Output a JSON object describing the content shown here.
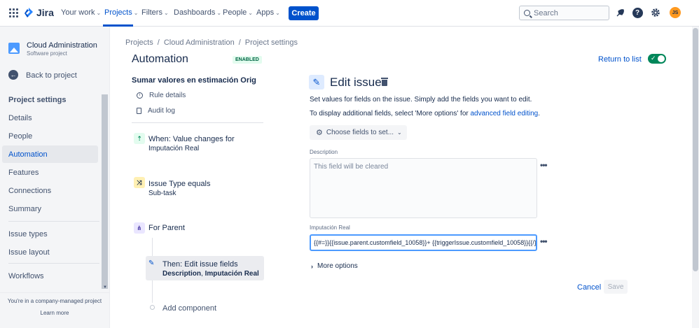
{
  "topnav": {
    "logo": "Jira",
    "items": [
      {
        "label": "Your work",
        "chevron": true
      },
      {
        "label": "Projects",
        "chevron": true,
        "active": true
      },
      {
        "label": "Filters",
        "chevron": true
      },
      {
        "label": "Dashboards",
        "chevron": true
      },
      {
        "label": "People",
        "chevron": true
      },
      {
        "label": "Apps",
        "chevron": true
      }
    ],
    "create_label": "Create",
    "search_placeholder": "Search",
    "avatar_initials": "JS",
    "icons": [
      "apps-grid-icon",
      "notification-icon",
      "help-icon",
      "settings-icon"
    ]
  },
  "sidebar": {
    "project_name": "Cloud Administration",
    "project_type": "Software project",
    "back_label": "Back to project",
    "heading": "Project settings",
    "items": [
      {
        "label": "Details"
      },
      {
        "label": "People"
      },
      {
        "label": "Automation",
        "active": true
      },
      {
        "label": "Features"
      },
      {
        "label": "Connections"
      },
      {
        "label": "Summary"
      },
      {
        "label": "Issue types"
      },
      {
        "label": "Issue layout"
      },
      {
        "label": "Workflows"
      }
    ],
    "footer_text": "You're in a company-managed project",
    "footer_link": "Learn more"
  },
  "breadcrumb": [
    "Projects",
    "/",
    "Cloud Administration",
    "/",
    "Project settings"
  ],
  "page": {
    "title": "Automation",
    "status_badge": "ENABLED",
    "return_label": "Return to list",
    "toggle_enabled": true
  },
  "rule": {
    "name": "Sumar valores en estimación Orig",
    "links": [
      "Rule details",
      "Audit log"
    ],
    "steps": [
      {
        "title": "When: Value changes for",
        "subtitle": "Imputación Real",
        "icon": "trigger-icon",
        "color": "#e3fcef"
      },
      {
        "title": "Issue Type equals",
        "subtitle": "Sub-task",
        "icon": "condition-icon",
        "color": "#fff0b3"
      },
      {
        "title": "For Parent",
        "subtitle": "",
        "icon": "branch-icon",
        "color": "#eae6ff"
      }
    ],
    "selected_action": {
      "title": "Then: Edit issue fields",
      "fields": [
        "Description",
        "Imputación Real"
      ],
      "separator": ", "
    },
    "add_component": "Add component"
  },
  "edit_panel": {
    "title": "Edit issue",
    "help_line1": "Set values for fields on the issue. Simply add the fields you want to edit.",
    "help_line2_prefix": "To display additional fields, select 'More options' for ",
    "help_line2_link": "advanced field editing",
    "help_line2_suffix": ".",
    "choose_fields_label": "Choose fields to set...",
    "description_label": "Description",
    "description_placeholder": "This field will be cleared",
    "imputacion_label": "Imputación Real",
    "imputacion_value": "{{#=}}{{issue.parent.customfield_10058}}+ {{triggerIssue.customfield_10058}}{{/}}",
    "more_options_label": "More options",
    "cancel_label": "Cancel",
    "save_label": "Save"
  }
}
